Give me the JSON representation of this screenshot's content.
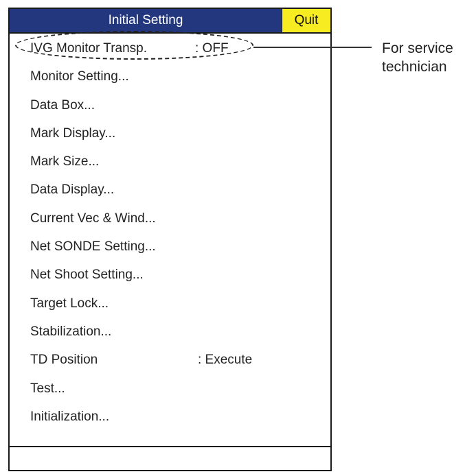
{
  "menu": {
    "title": "Initial Setting",
    "quit_label": "Quit",
    "colors": {
      "title_bar": "#23377f",
      "quit_button": "#f7ec21",
      "title_text": "#ffffff"
    },
    "items": [
      {
        "label": "IVG Monitor Transp.",
        "value": ": OFF"
      },
      {
        "label": "Monitor Setting..."
      },
      {
        "label": "Data Box..."
      },
      {
        "label": "Mark Display..."
      },
      {
        "label": "Mark Size..."
      },
      {
        "label": "Data Display..."
      },
      {
        "label": "Current Vec & Wind..."
      },
      {
        "label": "Net SONDE Setting..."
      },
      {
        "label": "Net Shoot Setting..."
      },
      {
        "label": "Target Lock..."
      },
      {
        "label": "Stabilization..."
      },
      {
        "label": "TD Position",
        "value": ": Execute"
      },
      {
        "label": "Test..."
      },
      {
        "label": "Initialization..."
      }
    ]
  },
  "callout": {
    "line1": "For service",
    "line2": "technician"
  }
}
